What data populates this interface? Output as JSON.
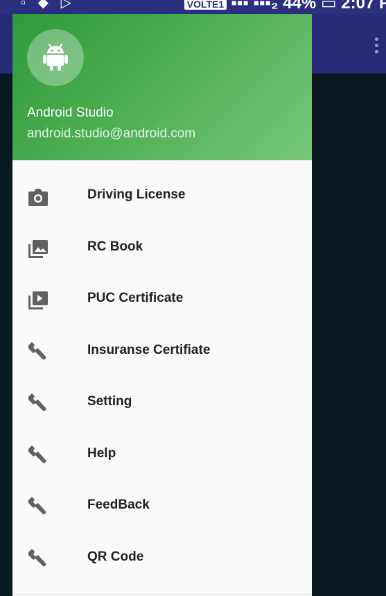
{
  "status_bar": {
    "left_icons": "▫ ◆ ▷",
    "volte": "VOLTE1",
    "right_text": "▪▪▪ ▪▪▪₂ 44% ▭ 2:07 P"
  },
  "drawer": {
    "header": {
      "avatar_icon": "android-icon",
      "name": "Android Studio",
      "email": "android.studio@android.com",
      "gradient_colors": [
        "#2f9a3b",
        "#78c77c"
      ]
    },
    "items": [
      {
        "icon": "camera-icon",
        "label": "Driving License"
      },
      {
        "icon": "photo-library-icon",
        "label": "RC Book"
      },
      {
        "icon": "video-library-icon",
        "label": "PUC Certificate"
      },
      {
        "icon": "wrench-icon",
        "label": "Insuranse Certifiate"
      },
      {
        "icon": "wrench-icon",
        "label": "Setting"
      },
      {
        "icon": "wrench-icon",
        "label": "Help"
      },
      {
        "icon": "wrench-icon",
        "label": "FeedBack"
      },
      {
        "icon": "wrench-icon",
        "label": "QR Code"
      }
    ]
  },
  "colors": {
    "app_bar": "#252b76",
    "scrim": "#0b1a21",
    "icon_gray": "#616161"
  }
}
